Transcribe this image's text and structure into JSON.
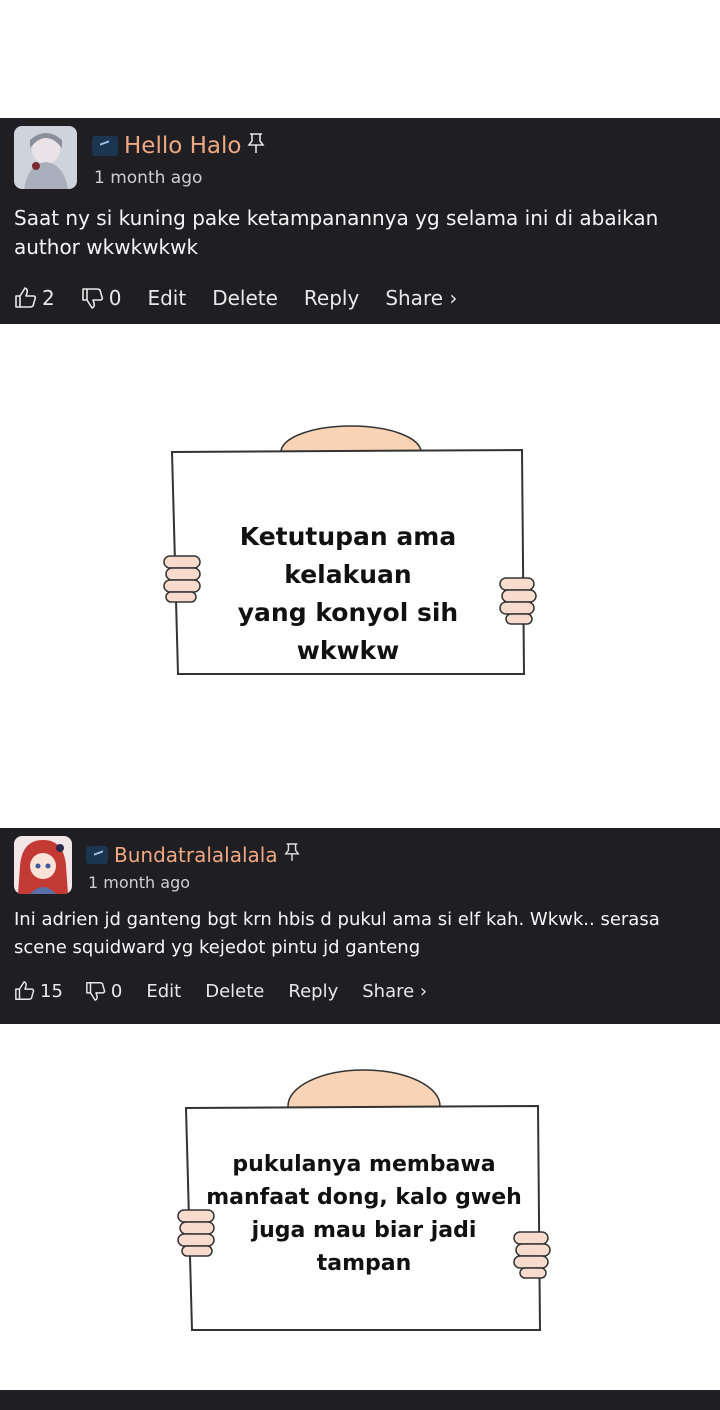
{
  "comments": [
    {
      "username": "Hello Halo",
      "time": "1 month ago",
      "text": "Saat ny si kuning pake ketampanannya yg selama ini di abaikan author wkwkwkwk",
      "likes": "2",
      "dislikes": "0",
      "edit_label": "Edit",
      "delete_label": "Delete",
      "reply_label": "Reply",
      "share_label": "Share ›"
    },
    {
      "username": "Bundatralalalala",
      "time": "1 month ago",
      "text": "Ini adrien jd ganteng bgt krn hbis d pukul ama si elf kah. Wkwk.. serasa scene squidward yg kejedot pintu jd ganteng",
      "likes": "15",
      "dislikes": "0",
      "edit_label": "Edit",
      "delete_label": "Delete",
      "reply_label": "Reply",
      "share_label": "Share ›"
    }
  ],
  "signs": [
    {
      "lines": [
        "Ketutupan ama kelakuan",
        "yang konyol sih wkwkw"
      ]
    },
    {
      "lines": [
        "pukulanya membawa",
        "manfaat dong, kalo gweh",
        "juga mau biar jadi",
        "tampan"
      ]
    }
  ],
  "colors": {
    "comment_bg": "#1f1e22",
    "username": "#f0a882",
    "sign_head": "#f9d3b5",
    "hand": "#f7dccd"
  },
  "icons": [
    "thumbs-up-icon",
    "thumbs-down-icon",
    "pin-icon",
    "badge-icon"
  ]
}
